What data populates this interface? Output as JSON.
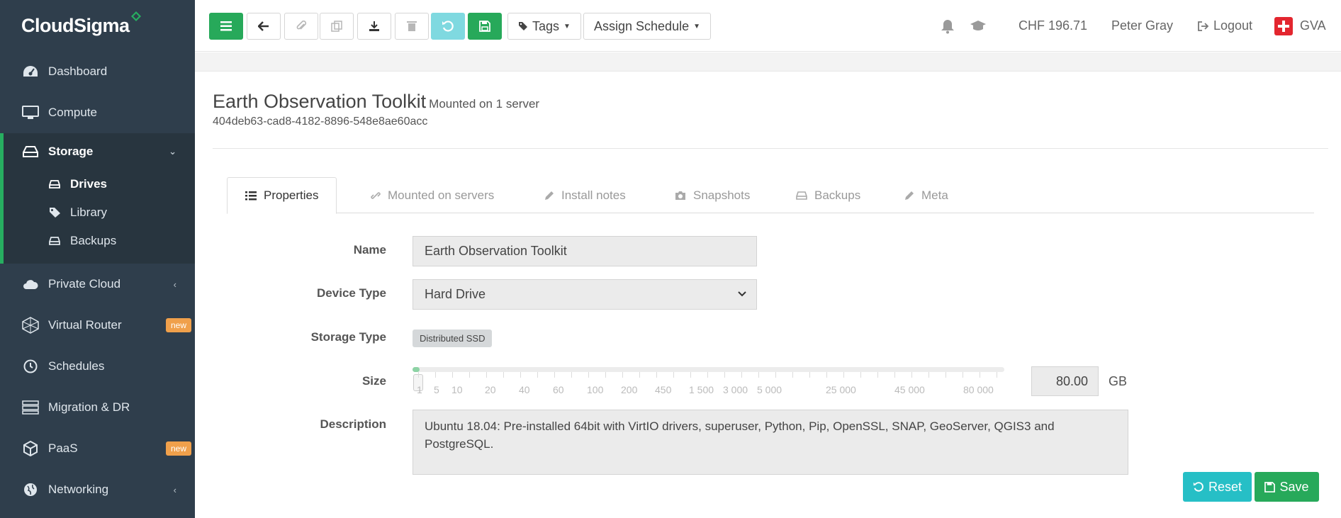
{
  "brand": {
    "name": "CloudSigma"
  },
  "sidebar": {
    "items": [
      {
        "label": "Dashboard",
        "icon": "dashboard-icon"
      },
      {
        "label": "Compute",
        "icon": "monitor-icon"
      },
      {
        "label": "Storage",
        "icon": "hdd-icon"
      },
      {
        "label": "Private Cloud",
        "icon": "cloud-icon"
      },
      {
        "label": "Virtual Router",
        "icon": "router-icon",
        "badge": "new"
      },
      {
        "label": "Schedules",
        "icon": "clock-icon"
      },
      {
        "label": "Migration & DR",
        "icon": "server-stack-icon"
      },
      {
        "label": "PaaS",
        "icon": "cube-icon",
        "badge": "new"
      },
      {
        "label": "Networking",
        "icon": "globe-icon"
      }
    ],
    "storage_sub": [
      {
        "label": "Drives",
        "icon": "hdd-icon"
      },
      {
        "label": "Library",
        "icon": "tags-icon"
      },
      {
        "label": "Backups",
        "icon": "hdd-icon"
      }
    ]
  },
  "toolbar": {
    "tags_label": "Tags",
    "schedule_label": "Assign Schedule"
  },
  "top_right": {
    "balance": "CHF 196.71",
    "user": "Peter Gray",
    "logout": "Logout",
    "location": "GVA"
  },
  "drive": {
    "name": "Earth Observation Toolkit",
    "mounted": "Mounted on 1 server",
    "uuid": "404deb63-cad8-4182-8896-548e8ae60acc"
  },
  "tabs": [
    "Properties",
    "Mounted on servers",
    "Install notes",
    "Snapshots",
    "Backups",
    "Meta"
  ],
  "form": {
    "name_label": "Name",
    "name_value": "Earth Observation Toolkit",
    "device_label": "Device Type",
    "device_value": "Hard Drive",
    "storage_label": "Storage Type",
    "storage_value": "Distributed SSD",
    "size_label": "Size",
    "size_value": "80.00",
    "size_unit": "GB",
    "size_ticks": [
      "1",
      "5",
      "10",
      "20",
      "40",
      "60",
      "100",
      "200",
      "450",
      "1 500",
      "3 000",
      "5 000",
      "25 000",
      "45 000",
      "80 000"
    ],
    "description_label": "Description",
    "description_value": "Ubuntu 18.04: Pre-installed 64bit with VirtIO drivers, superuser, Python, Pip, OpenSSL, SNAP, GeoServer, QGIS3 and PostgreSQL."
  },
  "actions": {
    "reset": "Reset",
    "save": "Save"
  },
  "colors": {
    "sidebar": "#2f3e4c",
    "accent": "#27ae60",
    "teal": "#26bfc6",
    "badge": "#f0a04b"
  }
}
